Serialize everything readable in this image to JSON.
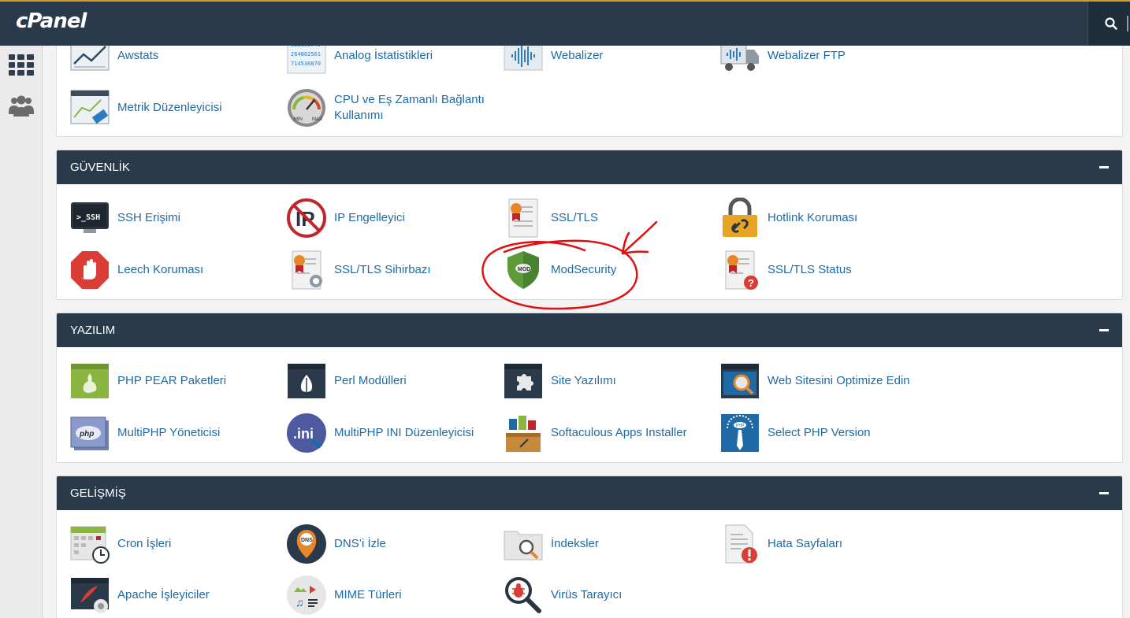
{
  "brand": {
    "logo_text": "cPanel"
  },
  "header": {
    "search_icon": "search-icon"
  },
  "sidebar": {
    "items": [
      {
        "icon": "grid-icon"
      },
      {
        "icon": "users-icon"
      }
    ]
  },
  "stats_panel": {
    "items": [
      {
        "label": "Awstats",
        "icon": "awstats-icon"
      },
      {
        "label": "Analog İstatistikleri",
        "icon": "analog-stats-icon"
      },
      {
        "label": "Webalizer",
        "icon": "webalizer-icon"
      },
      {
        "label": "Webalizer FTP",
        "icon": "webalizer-ftp-icon"
      },
      {
        "label": "Metrik Düzenleyicisi",
        "icon": "metric-editor-icon"
      },
      {
        "label": "CPU ve Eş Zamanlı Bağlantı Kullanımı",
        "icon": "cpu-gauge-icon"
      }
    ]
  },
  "security": {
    "title": "GÜVENLİK",
    "items": [
      {
        "label": "SSH Erişimi",
        "icon": "ssh-icon"
      },
      {
        "label": "IP Engelleyici",
        "icon": "ip-blocker-icon"
      },
      {
        "label": "SSL/TLS",
        "icon": "ssl-certificate-icon"
      },
      {
        "label": "Hotlink Koruması",
        "icon": "hotlink-lock-icon"
      },
      {
        "label": "Leech Koruması",
        "icon": "leech-hand-icon"
      },
      {
        "label": "SSL/TLS Sihirbazı",
        "icon": "ssl-wizard-icon"
      },
      {
        "label": "ModSecurity",
        "icon": "modsecurity-shield-icon"
      },
      {
        "label": "SSL/TLS Status",
        "icon": "ssl-status-icon"
      }
    ]
  },
  "software": {
    "title": "YAZILIM",
    "items": [
      {
        "label": "PHP PEAR Paketleri",
        "icon": "php-pear-icon"
      },
      {
        "label": "Perl Modülleri",
        "icon": "perl-onion-icon"
      },
      {
        "label": "Site Yazılımı",
        "icon": "puzzle-icon"
      },
      {
        "label": "Web Sitesini Optimize Edin",
        "icon": "optimize-icon"
      },
      {
        "label": "MultiPHP Yöneticisi",
        "icon": "multiphp-manager-icon"
      },
      {
        "label": "MultiPHP INI Düzenleyicisi",
        "icon": "ini-editor-icon"
      },
      {
        "label": "Softaculous Apps Installer",
        "icon": "softaculous-icon"
      },
      {
        "label": "Select PHP Version",
        "icon": "select-php-icon"
      }
    ]
  },
  "advanced": {
    "title": "GELİŞMİŞ",
    "items": [
      {
        "label": "Cron İşleri",
        "icon": "cron-calendar-icon"
      },
      {
        "label": "DNS’i İzle",
        "icon": "dns-pin-icon"
      },
      {
        "label": "İndeksler",
        "icon": "indexes-folder-icon"
      },
      {
        "label": "Hata Sayfaları",
        "icon": "error-pages-icon"
      },
      {
        "label": "Apache İşleyiciler",
        "icon": "apache-handlers-icon"
      },
      {
        "label": "MIME Türleri",
        "icon": "mime-types-icon"
      },
      {
        "label": "Virüs Tarayıcı",
        "icon": "virus-scanner-icon"
      }
    ]
  },
  "colors": {
    "header_bg": "#293a4a",
    "link": "#1f6aa5",
    "annotation": "#e01010"
  },
  "annotation": {
    "type": "hand-drawn-circle-and-arrow",
    "target": "ModSecurity"
  }
}
